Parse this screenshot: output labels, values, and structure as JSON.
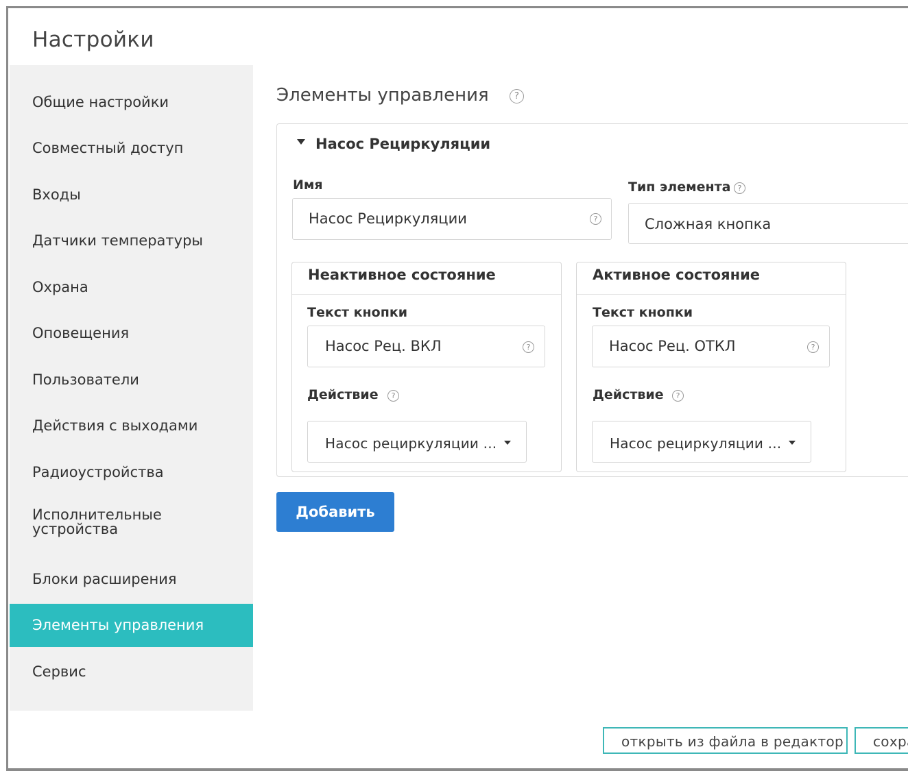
{
  "dialog": {
    "title": "Настройки"
  },
  "sidebar": {
    "items": [
      {
        "label": "Общие настройки"
      },
      {
        "label": "Совместный доступ"
      },
      {
        "label": "Входы"
      },
      {
        "label": "Датчики температуры"
      },
      {
        "label": "Охрана"
      },
      {
        "label": "Оповещения"
      },
      {
        "label": "Пользователи"
      },
      {
        "label": "Действия с выходами"
      },
      {
        "label": "Радиоустройства"
      },
      {
        "label": "Исполнительные",
        "label_line2": "устройства"
      },
      {
        "label": "Блоки расширения"
      },
      {
        "label": "Элементы управления",
        "active": true
      },
      {
        "label": "Сервис"
      }
    ],
    "active_color": "#2cbdbf"
  },
  "main": {
    "section_title": "Элементы управления",
    "help_glyph": "?",
    "element": {
      "header": "Насос Рециркуляции",
      "name_label": "Имя",
      "name_value": "Насос Рециркуляции",
      "type_label": "Тип элемента",
      "type_value": "Сложная кнопка",
      "inactive": {
        "title": "Неактивное состояние",
        "button_text_label": "Текст кнопки",
        "button_text_value": "Насос Рец. ВКЛ",
        "action_label": "Действие",
        "action_value": "Насос рециркуляции ..."
      },
      "active": {
        "title": "Активное состояние",
        "button_text_label": "Текст кнопки",
        "button_text_value": "Насос Рец. ОТКЛ",
        "action_label": "Действие",
        "action_value": "Насос рециркуляции ..."
      }
    },
    "add_button": "Добавить",
    "add_button_color": "#2d7ed2"
  },
  "footer": {
    "open_file_button": "открыть из файла в редактор",
    "save_button_partial": "сохра"
  },
  "icons": {
    "help": "help-circle-icon",
    "collapse": "triangle-down-icon",
    "dropdown": "caret-down-icon"
  }
}
